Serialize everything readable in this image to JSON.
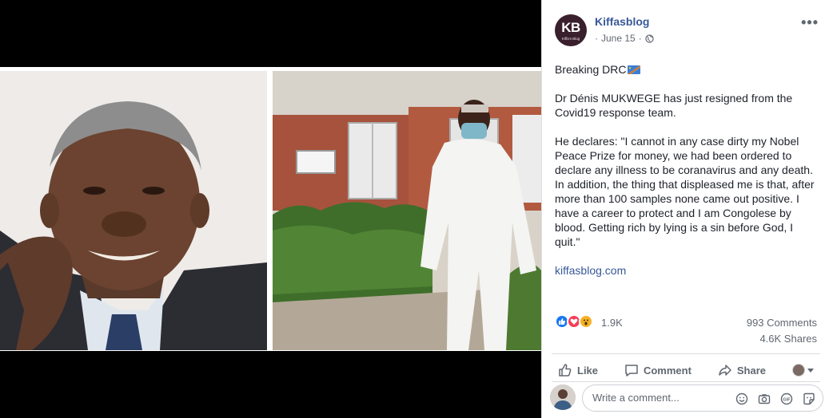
{
  "post": {
    "page_name": "Kiffasblog",
    "avatar_initials": "KB",
    "avatar_subtitle": "Kiffa's Blog",
    "date": "June 15",
    "date_separator": "·",
    "more_label": "•••",
    "paragraphs": [
      "Breaking DRC",
      "Dr Dénis MUKWEGE has just resigned from the Covid19 response team.",
      "He declares: \"I cannot in any case dirty my Nobel Peace Prize for money, we had been ordered to declare any illness to be coranavirus and any death. In addition, the thing that displeased me is that, after more than 100 samples none came out positive. I have a career to protect and I am Congolese by blood. Getting rich by lying is a sin before God, I quit.\""
    ],
    "link_text": "kiffasblog.com",
    "icons": {
      "privacy": "globe-icon",
      "flag": "drc-flag-icon"
    }
  },
  "stats": {
    "reactions_count": "1.9K",
    "reaction_types": [
      "like",
      "love",
      "wow"
    ],
    "comments": "993 Comments",
    "shares": "4.6K Shares"
  },
  "actions": {
    "like": "Like",
    "comment": "Comment",
    "share": "Share"
  },
  "comment_input": {
    "placeholder": "Write a comment..."
  },
  "colors": {
    "link": "#385898",
    "like_blue": "#1877f2",
    "love_red": "#f33e58",
    "wow_yellow": "#f7b125",
    "avatar_bg": "#3a1f2c"
  }
}
